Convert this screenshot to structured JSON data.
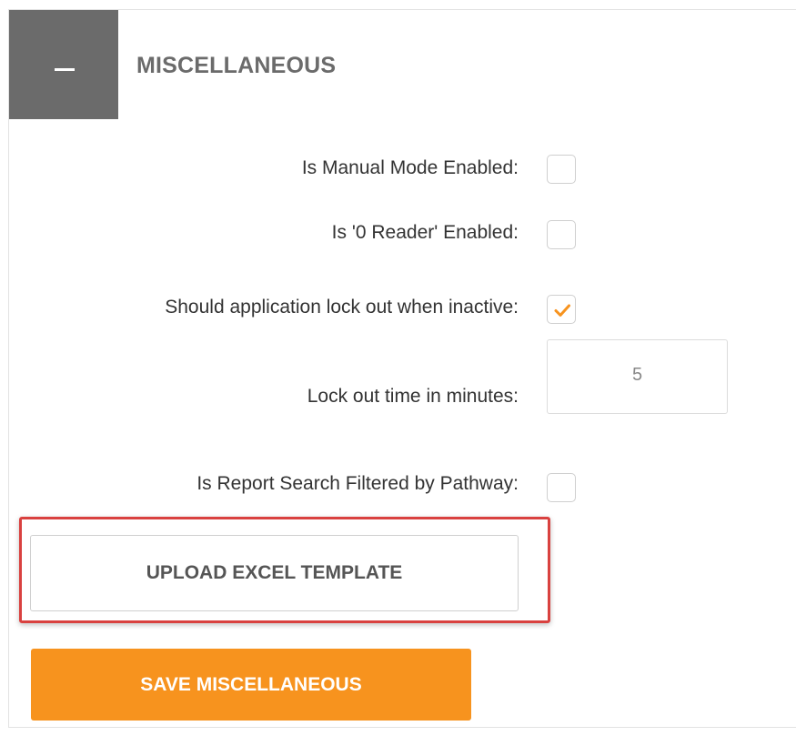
{
  "section": {
    "title": "MISCELLANEOUS",
    "collapse_icon": "minus-icon"
  },
  "fields": {
    "manual_mode": {
      "label": "Is Manual Mode Enabled:",
      "checked": false
    },
    "zero_reader": {
      "label": "Is '0 Reader' Enabled:",
      "checked": false
    },
    "lock_out_inactive": {
      "label": "Should application lock out when inactive:",
      "checked": true
    },
    "lock_out_time": {
      "label": "Lock out time in minutes:",
      "value": "5"
    },
    "report_search_filtered": {
      "label": "Is Report Search Filtered by Pathway:",
      "checked": false
    }
  },
  "buttons": {
    "upload_label": "UPLOAD EXCEL TEMPLATE",
    "save_label": "SAVE MISCELLANEOUS"
  },
  "colors": {
    "header_bg": "#6b6b6b",
    "accent": "#f7931e",
    "highlight": "#d9413f"
  }
}
